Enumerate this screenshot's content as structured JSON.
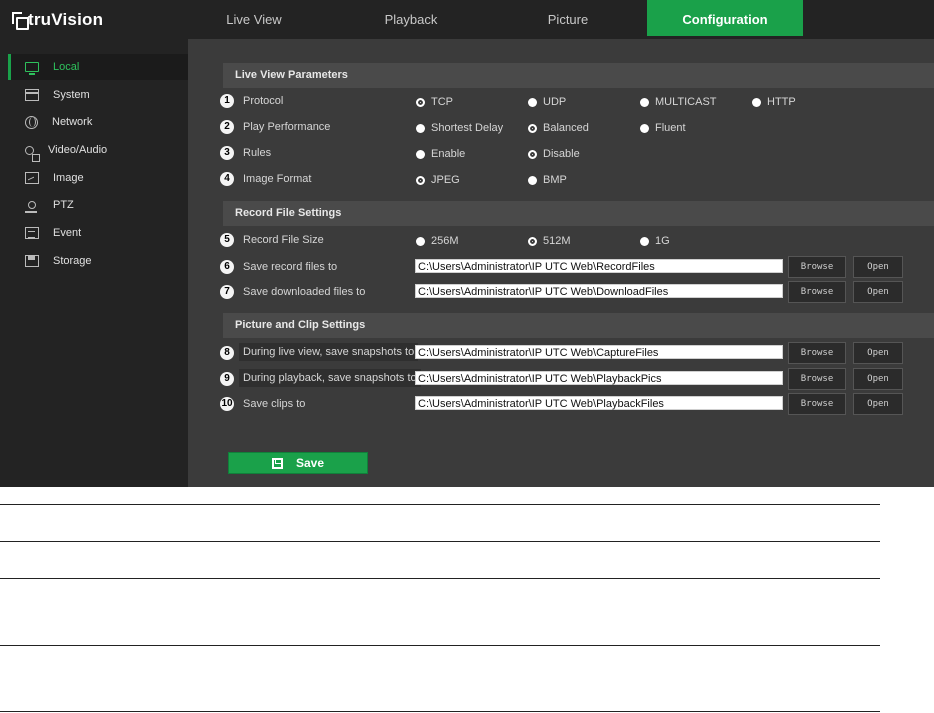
{
  "brand": {
    "logo_text": "truVision"
  },
  "tabs": [
    {
      "label": "Live View",
      "active": false
    },
    {
      "label": "Playback",
      "active": false
    },
    {
      "label": "Picture",
      "active": false
    },
    {
      "label": "Configuration",
      "active": true
    }
  ],
  "sidebar": {
    "items": [
      {
        "label": "Local",
        "icon": "monitor-icon",
        "active": true
      },
      {
        "label": "System",
        "icon": "window-icon",
        "active": false
      },
      {
        "label": "Network",
        "icon": "globe-icon",
        "active": false
      },
      {
        "label": "Video/Audio",
        "icon": "video-audio-icon",
        "active": false
      },
      {
        "label": "Image",
        "icon": "image-icon",
        "active": false
      },
      {
        "label": "PTZ",
        "icon": "ptz-icon",
        "active": false
      },
      {
        "label": "Event",
        "icon": "event-icon",
        "active": false
      },
      {
        "label": "Storage",
        "icon": "storage-icon",
        "active": false
      }
    ]
  },
  "sections": {
    "live_view": "Live View Parameters",
    "record_file": "Record File Settings",
    "picture_clip": "Picture and Clip Settings"
  },
  "rows": {
    "protocol": {
      "num": "1",
      "label": "Protocol",
      "options": [
        "TCP",
        "UDP",
        "MULTICAST",
        "HTTP"
      ],
      "selected": "TCP"
    },
    "play_performance": {
      "num": "2",
      "label": "Play Performance",
      "options": [
        "Shortest Delay",
        "Balanced",
        "Fluent"
      ],
      "selected": "Balanced"
    },
    "rules": {
      "num": "3",
      "label": "Rules",
      "options": [
        "Enable",
        "Disable"
      ],
      "selected": "Disable"
    },
    "image_format": {
      "num": "4",
      "label": "Image Format",
      "options": [
        "JPEG",
        "BMP"
      ],
      "selected": "JPEG"
    },
    "record_file_size": {
      "num": "5",
      "label": "Record File Size",
      "options": [
        "256M",
        "512M",
        "1G"
      ],
      "selected": "512M"
    },
    "save_record": {
      "num": "6",
      "label": "Save record files to",
      "path": "C:\\Users\\Administrator\\IP UTC Web\\RecordFiles"
    },
    "save_downloaded": {
      "num": "7",
      "label": "Save downloaded files to",
      "path": "C:\\Users\\Administrator\\IP UTC Web\\DownloadFiles"
    },
    "live_snapshots": {
      "num": "8",
      "label": "During live view, save snapshots to",
      "path": "C:\\Users\\Administrator\\IP UTC Web\\CaptureFiles"
    },
    "playback_snapshots": {
      "num": "9",
      "label": "During playback, save snapshots to",
      "path": "C:\\Users\\Administrator\\IP UTC Web\\PlaybackPics"
    },
    "save_clips": {
      "num": "10",
      "label": "Save clips to",
      "path": "C:\\Users\\Administrator\\IP UTC Web\\PlaybackFiles"
    }
  },
  "buttons": {
    "browse": "Browse",
    "open": "Open",
    "save": "Save"
  },
  "colors": {
    "accent": "#1aa14a",
    "background": "#3b3b3b",
    "sidebar": "#232323"
  }
}
